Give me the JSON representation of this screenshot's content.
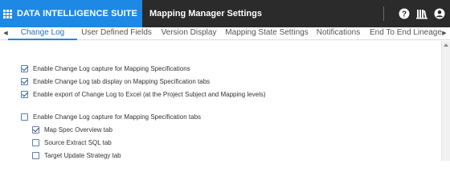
{
  "header": {
    "brand_title": "DATA INTELLIGENCE SUITE",
    "page_title": "Mapping Manager Settings",
    "icons": [
      "grid-icon",
      "help-icon",
      "library-icon",
      "user-icon"
    ],
    "brand_color": "#1e88e5",
    "bar_color": "#2b2b2b"
  },
  "tabs": [
    {
      "label": "Change Log",
      "active": true
    },
    {
      "label": "User Defined Fields",
      "active": false
    },
    {
      "label": "Version Display",
      "active": false
    },
    {
      "label": "Mapping State Settings",
      "active": false
    },
    {
      "label": "Notifications",
      "active": false
    },
    {
      "label": "End To End Lineage",
      "active": false
    }
  ],
  "options": [
    {
      "label": "Enable Change Log capture for Mapping Specifications",
      "checked": true
    },
    {
      "label": "Enable Change Log tab display on Mapping Specification tabs",
      "checked": true
    },
    {
      "label": "Enable export of Change Log to Excel (at the Project Subject and Mapping levels)",
      "checked": true
    },
    {
      "label": "Enable Change Log capture for Mapping Specification tabs",
      "checked": false
    },
    {
      "label": "Map Spec Overview tab",
      "checked": true
    },
    {
      "label": "Source Extract SQL tab",
      "checked": false
    },
    {
      "label": "Target Update Strategy tab",
      "checked": false
    }
  ]
}
